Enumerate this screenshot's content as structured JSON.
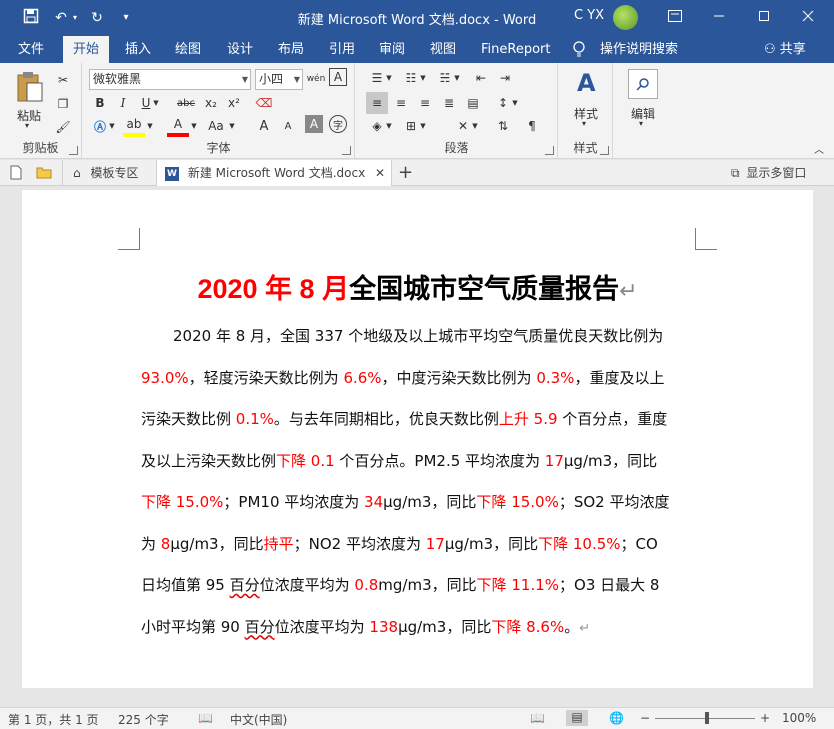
{
  "titlebar": {
    "title": "新建 Microsoft Word 文档.docx  -  Word",
    "user": "C YX",
    "minimize_icon": "minimize-icon",
    "restore_icon": "ribbon-display-icon",
    "close_icon": "close-icon"
  },
  "tabs": [
    "文件",
    "开始",
    "插入",
    "绘图",
    "设计",
    "布局",
    "引用",
    "审阅",
    "视图",
    "FineReport"
  ],
  "active_tab": "开始",
  "tell_me": "操作说明搜索",
  "share": "共享",
  "ribbon": {
    "clipboard": {
      "label": "剪贴板",
      "paste": "粘贴"
    },
    "font": {
      "label": "字体",
      "font_name": "微软雅黑",
      "font_size": "小四",
      "wen": "wén",
      "A": "A",
      "bold": "B",
      "italic": "I",
      "underline": "U",
      "strike": "abc",
      "subscript": "x₂",
      "superscript": "x²",
      "grow": "A",
      "shrink": "A",
      "case": "Aa",
      "zi": "字"
    },
    "paragraph": {
      "label": "段落"
    },
    "styles": {
      "label": "样式",
      "button": "样式"
    },
    "editing": {
      "button": "编辑"
    }
  },
  "docstrip": {
    "template_tab": "模板专区",
    "doc_tab": "新建 Microsoft Word 文档.docx",
    "multi_window": "显示多窗口"
  },
  "document": {
    "title_red": "2020 年 8 月",
    "title_black": "全国城市空气质量报告",
    "return_mark": "↵"
  },
  "statusbar": {
    "page": "第 1 页，共 1 页",
    "words": "225 个字",
    "language": "中文(中国)",
    "zoom": "100%",
    "zoom_level": 1.0
  },
  "colors": {
    "title_bar": "#2b579a",
    "ribbon": "#f3f3f3",
    "highlight_red": "#ff0000"
  }
}
